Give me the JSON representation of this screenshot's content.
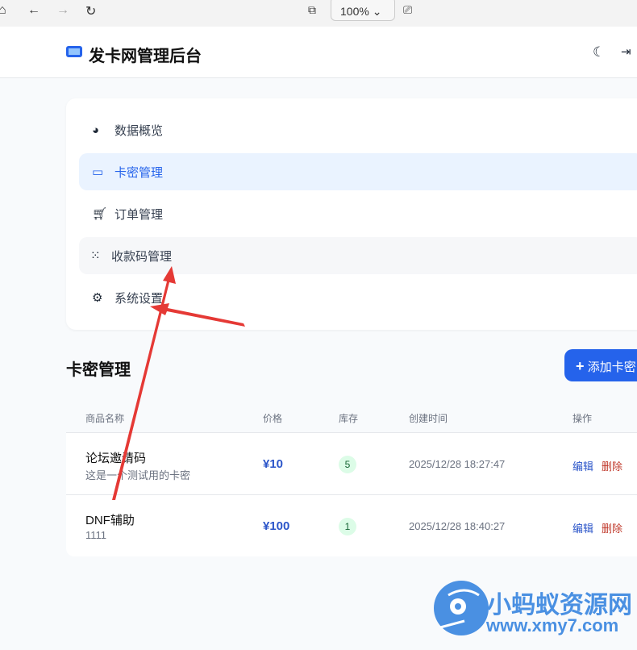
{
  "browser": {
    "zoom": "100%"
  },
  "header": {
    "title": "发卡网管理后台"
  },
  "nav": {
    "items": [
      {
        "label": "数据概览",
        "icon": "pie-chart-icon"
      },
      {
        "label": "卡密管理",
        "icon": "ticket-icon",
        "active": true
      },
      {
        "label": "订单管理",
        "icon": "cart-icon"
      },
      {
        "label": "收款码管理",
        "icon": "qrcode-icon"
      },
      {
        "label": "系统设置",
        "icon": "gear-icon"
      }
    ]
  },
  "section": {
    "title": "卡密管理",
    "add_label": "添加卡密"
  },
  "table": {
    "headers": [
      "商品名称",
      "价格",
      "库存",
      "创建时间",
      "操作"
    ],
    "rows": [
      {
        "name": "论坛邀请码",
        "desc": "这是一个测试用的卡密",
        "price": "¥10",
        "stock": "5",
        "created": "2025/12/28 18:27:47",
        "edit": "编辑",
        "delete": "删除"
      },
      {
        "name": "DNF辅助",
        "desc": "1111",
        "price": "¥100",
        "stock": "1",
        "created": "2025/12/28 18:40:27",
        "edit": "编辑",
        "delete": "删除"
      }
    ]
  },
  "watermark": {
    "title": "小蚂蚁资源网",
    "url": "www.xmy7.com"
  },
  "colors": {
    "accent": "#2563eb",
    "danger": "#c0392b",
    "annotation": "#e53935"
  }
}
